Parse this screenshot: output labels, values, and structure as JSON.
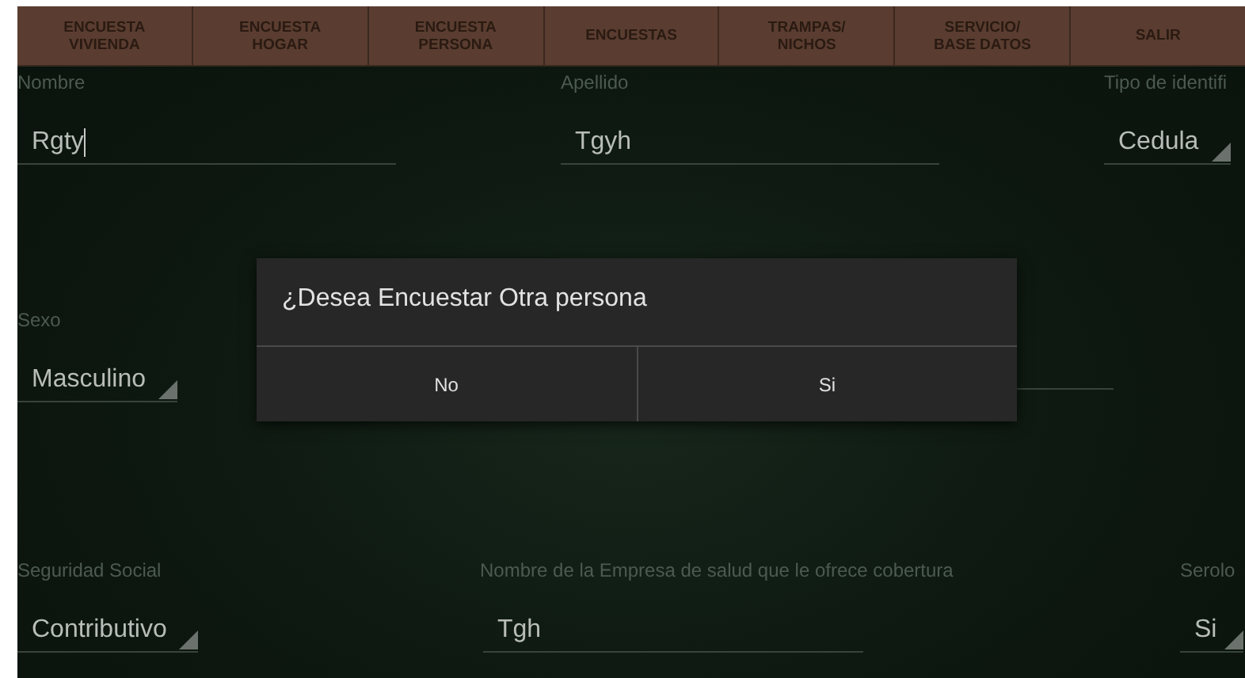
{
  "nav_tabs": [
    {
      "label": "ENCUESTA\nVIVIENDA"
    },
    {
      "label": "ENCUESTA\nHOGAR"
    },
    {
      "label": "ENCUESTA\nPERSONA"
    },
    {
      "label": "ENCUESTAS"
    },
    {
      "label": "TRAMPAS/\nNICHOS"
    },
    {
      "label": "SERVICIO/\nBASE DATOS"
    },
    {
      "label": "SALIR"
    }
  ],
  "form_rows": [
    {
      "fields": [
        {
          "kind": "text",
          "label": "Nombre",
          "value": "Rgty",
          "focused": true
        },
        {
          "kind": "text",
          "label": "Apellido",
          "value": "Tgyh",
          "focused": false
        },
        {
          "kind": "spinner",
          "label": "Tipo de identifi",
          "value": "Cedula"
        }
      ]
    },
    {
      "fields": [
        {
          "kind": "spinner",
          "label": "Sexo",
          "value": "Masculino"
        },
        {
          "kind": "text"
        }
      ]
    },
    {
      "fields": [
        {
          "kind": "spinner",
          "label": "Seguridad Social",
          "value": "Contributivo"
        },
        {
          "kind": "text",
          "label": "Nombre de la Empresa de salud que le ofrece cobertura",
          "value": "Tgh",
          "focused": false
        },
        {
          "kind": "spinner",
          "label": "Serolo",
          "value": "Si"
        }
      ]
    }
  ],
  "dialog": {
    "title": "¿Desea Encuestar Otra persona",
    "buttons": [
      "No",
      "Si"
    ]
  }
}
